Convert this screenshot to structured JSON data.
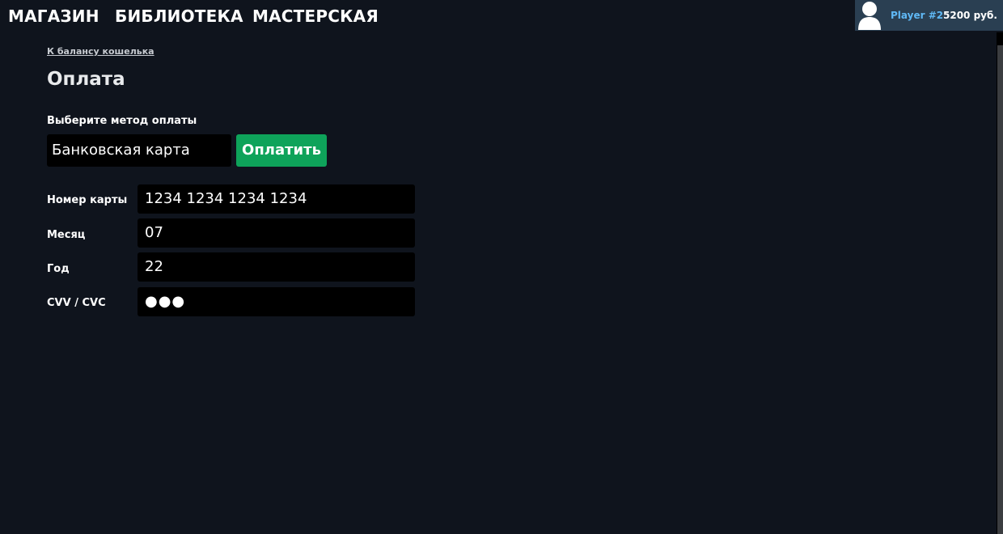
{
  "nav": {
    "store": "МАГАЗИН",
    "library": "БИБЛИОТЕКА",
    "workshop": "МАСТЕРСКАЯ"
  },
  "user": {
    "avatar_icon": "user-silhouette-icon",
    "name": "Player #2",
    "balance": "5200 руб."
  },
  "page": {
    "back_link": "К балансу кошелька",
    "title": "Оплата"
  },
  "payment": {
    "method_label": "Выберите метод оплаты",
    "method_value": "Банковская карта",
    "pay_button": "Оплатить"
  },
  "fields": {
    "card_number": {
      "label": "Номер карты",
      "value": "1234 1234 1234 1234"
    },
    "month": {
      "label": "Месяц",
      "value": "07"
    },
    "year": {
      "label": "Год",
      "value": "22"
    },
    "cvv": {
      "label": "CVV / CVC",
      "value": "●●●"
    }
  },
  "colors": {
    "background": "#0f141d",
    "accent_green": "#0ea35a",
    "user_name_blue": "#5fb8f5",
    "user_box": "#2a3f52"
  }
}
